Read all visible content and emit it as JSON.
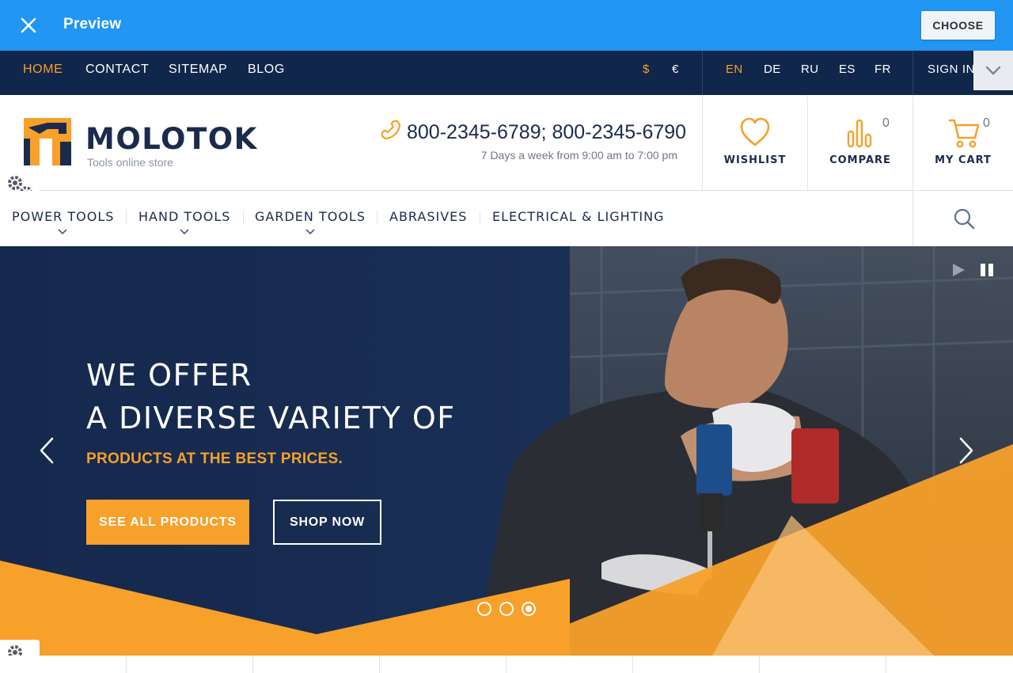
{
  "preview_bar": {
    "title": "Preview",
    "choose_label": "CHOOSE"
  },
  "topbar": {
    "nav": [
      {
        "label": "HOME",
        "active": true
      },
      {
        "label": "CONTACT",
        "active": false
      },
      {
        "label": "SITEMAP",
        "active": false
      },
      {
        "label": "BLOG",
        "active": false
      }
    ],
    "currencies": [
      {
        "symbol": "$",
        "active": true
      },
      {
        "symbol": "€",
        "active": false
      }
    ],
    "languages": [
      {
        "code": "EN",
        "active": true
      },
      {
        "code": "DE",
        "active": false
      },
      {
        "code": "RU",
        "active": false
      },
      {
        "code": "ES",
        "active": false
      },
      {
        "code": "FR",
        "active": false
      }
    ],
    "sign_in": "SIGN IN"
  },
  "header": {
    "logo_name": "MOLOTOK",
    "logo_tagline": "Tools online store",
    "phone": "800-2345-6789; 800-2345-6790",
    "hours": "7 Days a week from 9:00 am to 7:00 pm",
    "wishlist": {
      "label": "WISHLIST"
    },
    "compare": {
      "label": "COMPARE",
      "count": "0"
    },
    "cart": {
      "label": "MY CART",
      "count": "0"
    }
  },
  "categories": [
    {
      "label": "POWER TOOLS",
      "has_dropdown": true
    },
    {
      "label": "HAND TOOLS",
      "has_dropdown": true
    },
    {
      "label": "GARDEN TOOLS",
      "has_dropdown": true
    },
    {
      "label": "ABRASIVES",
      "has_dropdown": false
    },
    {
      "label": "ELECTRICAL & LIGHTING",
      "has_dropdown": false
    }
  ],
  "hero": {
    "line1": "WE OFFER",
    "line2": "A DIVERSE VARIETY OF",
    "subline": "PRODUCTS AT THE BEST PRICES.",
    "primary_button": "SEE ALL PRODUCTS",
    "secondary_button": "SHOP NOW",
    "slides_total": 3,
    "active_slide": 3
  },
  "colors": {
    "preview_bar": "#2196f3",
    "topbar": "#10264a",
    "accent": "#f7a02a",
    "brand_navy": "#1a2b4c"
  },
  "icons": {
    "close": "close-icon",
    "dropdown": "chevron-down-icon",
    "logo": "hammer-logo-icon",
    "phone": "phone-icon",
    "wishlist": "heart-icon",
    "compare": "bar-chart-icon",
    "cart": "cart-icon",
    "search": "search-icon",
    "settings": "gears-icon",
    "prev": "chevron-left-icon",
    "next": "chevron-right-icon",
    "play": "play-icon",
    "pause": "pause-icon"
  }
}
